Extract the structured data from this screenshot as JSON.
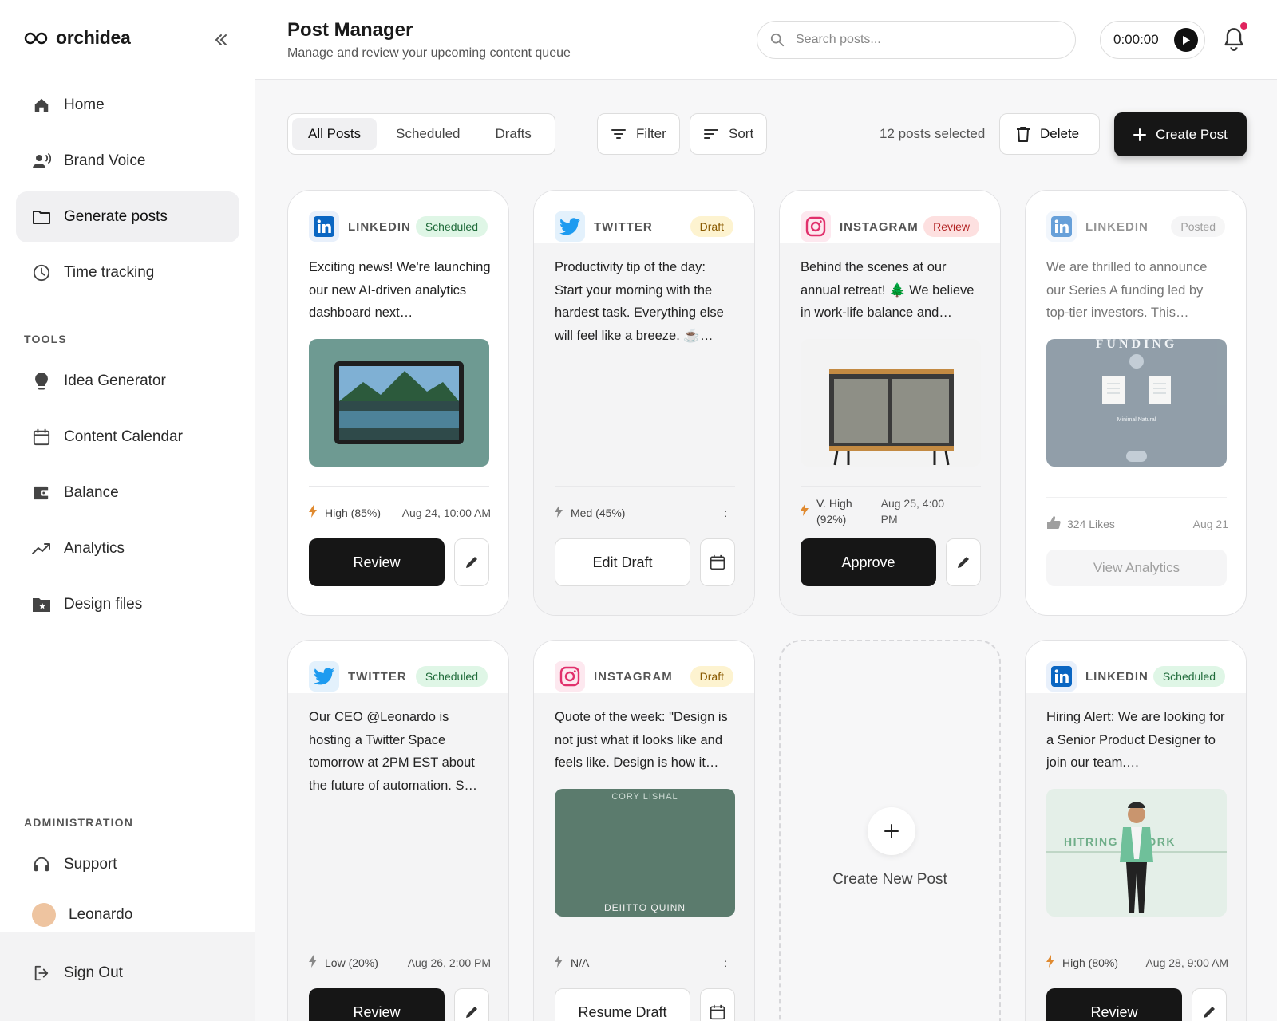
{
  "app": {
    "name": "orchidea"
  },
  "sidebar": {
    "items": [
      {
        "label": "Home",
        "icon": "home-icon"
      },
      {
        "label": "Brand Voice",
        "icon": "voice-icon"
      },
      {
        "label": "Generate posts",
        "icon": "folder-icon",
        "active": true
      },
      {
        "label": "Time tracking",
        "icon": "clock-icon"
      }
    ],
    "tools_label": "TOOLS",
    "tools": [
      {
        "label": "Idea Generator",
        "icon": "bulb-icon"
      },
      {
        "label": "Content Calendar",
        "icon": "calendar-icon"
      },
      {
        "label": "Balance",
        "icon": "wallet-icon"
      },
      {
        "label": "Analytics",
        "icon": "trend-icon"
      },
      {
        "label": "Design files",
        "icon": "star-folder-icon"
      }
    ],
    "admin_label": "ADMINISTRATION",
    "support": "Support",
    "user": "Leonardo",
    "signout": "Sign Out"
  },
  "header": {
    "title": "Post Manager",
    "subtitle": "Manage and review your upcoming content queue",
    "search_placeholder": "Search posts...",
    "timer": "0:00:00"
  },
  "toolbar": {
    "tabs": [
      "All Posts",
      "Scheduled",
      "Drafts"
    ],
    "filter": "Filter",
    "sort": "Sort",
    "selected": "12 posts selected",
    "delete": "Delete",
    "create": "Create Post"
  },
  "colors": {
    "accent": "#161616",
    "linkedin": "#0a66c2",
    "twitter": "#1d9bf0",
    "instagram": "#e1306c"
  },
  "posts": [
    {
      "platform": "LINKEDIN",
      "status": "Scheduled",
      "text": "Exciting news! We're launching our new AI-driven analytics dashboard next…",
      "score": "High (85%)",
      "date": "Aug 24, 10:00 AM",
      "action": "Review"
    },
    {
      "platform": "TWITTER",
      "status": "Draft",
      "text": "Productivity tip of the day: Start your morning with the hardest task. Everything else will feel like a breeze. ☕…",
      "score": "Med (45%)",
      "date": "– : –",
      "action": "Edit Draft"
    },
    {
      "platform": "INSTAGRAM",
      "status": "Review",
      "text": "Behind the scenes at our annual retreat! 🌲 We believe in work-life balance and…",
      "score_line1": "V. High",
      "score_line2": "(92%)",
      "date_line1": "Aug 25, 4:00",
      "date_line2": "PM",
      "action": "Approve"
    },
    {
      "platform": "LINKEDIN",
      "status": "Posted",
      "text": "We are thrilled to announce our Series A funding led by top-tier investors. This…",
      "likes": "324 Likes",
      "date": "Aug 21",
      "action": "View Analytics",
      "img_title": "FUNDING",
      "img_caption": "Minimal Natural"
    },
    {
      "platform": "TWITTER",
      "status": "Scheduled",
      "text": "Our CEO @Leonardo is hosting a Twitter Space tomorrow at 2PM EST about the future of automation. S…",
      "score": "Low (20%)",
      "date": "Aug 26, 2:00 PM",
      "action": "Review"
    },
    {
      "platform": "INSTAGRAM",
      "status": "Draft",
      "text": "Quote of the week: \"Design is not just what it looks like and feels like. Design is how it…",
      "score": "N/A",
      "date": "– : –",
      "action": "Resume Draft",
      "img_top": "CORY LISHAL",
      "img_bottom": "DEIITTO QUINN"
    },
    {
      "platform": "LINKEDIN",
      "status": "Scheduled",
      "text": "Hiring Alert: We are looking for a Senior Product Designer to join our team.…",
      "score": "High (80%)",
      "date": "Aug 28, 9:00 AM",
      "action": "Review",
      "img_text": "HITRING E WORK"
    }
  ],
  "create_new": "Create New Post"
}
